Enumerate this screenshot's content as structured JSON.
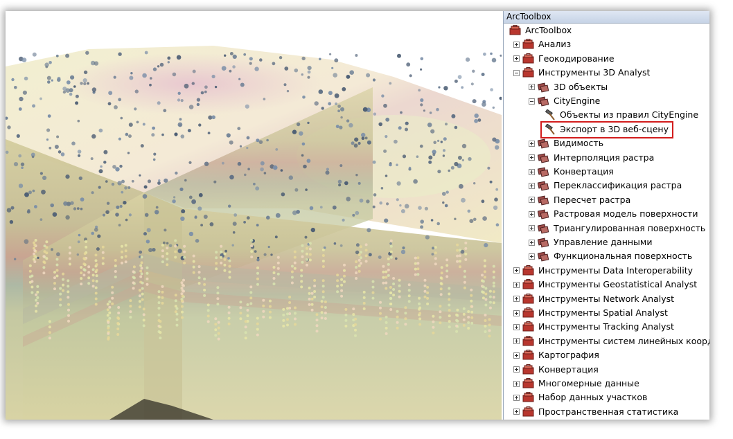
{
  "panel": {
    "title": "ArcToolbox"
  },
  "tree": [
    {
      "label": "ArcToolbox",
      "level": 0,
      "expander": "none",
      "icon": "toolbox-root-icon",
      "name": "tree-item-arctoolbox"
    },
    {
      "label": "Анализ",
      "level": 1,
      "expander": "plus",
      "icon": "toolbox-icon",
      "name": "tree-item-analysis"
    },
    {
      "label": "Геокодирование",
      "level": 1,
      "expander": "plus",
      "icon": "toolbox-icon",
      "name": "tree-item-geocoding"
    },
    {
      "label": "Инструменты 3D Analyst",
      "level": 1,
      "expander": "minus",
      "icon": "toolbox-icon",
      "name": "tree-item-3d-analyst"
    },
    {
      "label": "3D объекты",
      "level": 2,
      "expander": "plus",
      "icon": "toolset-icon",
      "name": "tree-item-3d-objects"
    },
    {
      "label": "CityEngine",
      "level": 2,
      "expander": "minus",
      "icon": "toolset-icon",
      "name": "tree-item-cityengine"
    },
    {
      "label": "Объекты из правил CityEngine",
      "level": 3,
      "expander": "none",
      "icon": "hammer-icon",
      "name": "tree-item-features-from-rules"
    },
    {
      "label": "Экспорт в 3D веб-сцену",
      "level": 3,
      "expander": "none",
      "icon": "hammer-icon",
      "name": "tree-item-export-3d-web-scene",
      "highlight": true
    },
    {
      "label": "Видимость",
      "level": 2,
      "expander": "plus",
      "icon": "toolset-icon",
      "name": "tree-item-visibility"
    },
    {
      "label": "Интерполяция растра",
      "level": 2,
      "expander": "plus",
      "icon": "toolset-icon",
      "name": "tree-item-raster-interpolation"
    },
    {
      "label": "Конвертация",
      "level": 2,
      "expander": "plus",
      "icon": "toolset-icon",
      "name": "tree-item-conversion-3d"
    },
    {
      "label": "Переклассификация растра",
      "level": 2,
      "expander": "plus",
      "icon": "toolset-icon",
      "name": "tree-item-raster-reclass"
    },
    {
      "label": "Пересчет растра",
      "level": 2,
      "expander": "plus",
      "icon": "toolset-icon",
      "name": "tree-item-raster-math"
    },
    {
      "label": "Растровая модель поверхности",
      "level": 2,
      "expander": "plus",
      "icon": "toolset-icon",
      "name": "tree-item-raster-surface"
    },
    {
      "label": "Триангулированная поверхность",
      "level": 2,
      "expander": "plus",
      "icon": "toolset-icon",
      "name": "tree-item-triangulated-surface"
    },
    {
      "label": "Управление данными",
      "level": 2,
      "expander": "plus",
      "icon": "toolset-icon",
      "name": "tree-item-data-management-3d"
    },
    {
      "label": "Функциональная поверхность",
      "level": 2,
      "expander": "plus",
      "icon": "toolset-icon",
      "name": "tree-item-functional-surface"
    },
    {
      "label": "Инструменты Data Interoperability",
      "level": 1,
      "expander": "plus",
      "icon": "toolbox-icon",
      "name": "tree-item-data-interop"
    },
    {
      "label": "Инструменты Geostatistical Analyst",
      "level": 1,
      "expander": "plus",
      "icon": "toolbox-icon",
      "name": "tree-item-geostatistical"
    },
    {
      "label": "Инструменты Network Analyst",
      "level": 1,
      "expander": "plus",
      "icon": "toolbox-icon",
      "name": "tree-item-network"
    },
    {
      "label": "Инструменты Spatial Analyst",
      "level": 1,
      "expander": "plus",
      "icon": "toolbox-icon",
      "name": "tree-item-spatial"
    },
    {
      "label": "Инструменты Tracking Analyst",
      "level": 1,
      "expander": "plus",
      "icon": "toolbox-icon",
      "name": "tree-item-tracking"
    },
    {
      "label": "Инструменты систем линейных коорд",
      "level": 1,
      "expander": "plus",
      "icon": "toolbox-icon",
      "name": "tree-item-linear-ref"
    },
    {
      "label": "Картография",
      "level": 1,
      "expander": "plus",
      "icon": "toolbox-icon",
      "name": "tree-item-cartography"
    },
    {
      "label": "Конвертация",
      "level": 1,
      "expander": "plus",
      "icon": "toolbox-icon",
      "name": "tree-item-conversion"
    },
    {
      "label": "Многомерные данные",
      "level": 1,
      "expander": "plus",
      "icon": "toolbox-icon",
      "name": "tree-item-multidimension"
    },
    {
      "label": "Набор данных участков",
      "level": 1,
      "expander": "plus",
      "icon": "toolbox-icon",
      "name": "tree-item-parcel-fabric"
    },
    {
      "label": "Пространственная статистика",
      "level": 1,
      "expander": "plus",
      "icon": "toolbox-icon",
      "name": "tree-item-spatial-stats"
    }
  ],
  "colors": {
    "highlight": "#d21c1c",
    "toolbox": "#b8362e",
    "toolset": "#8a3a3a"
  }
}
